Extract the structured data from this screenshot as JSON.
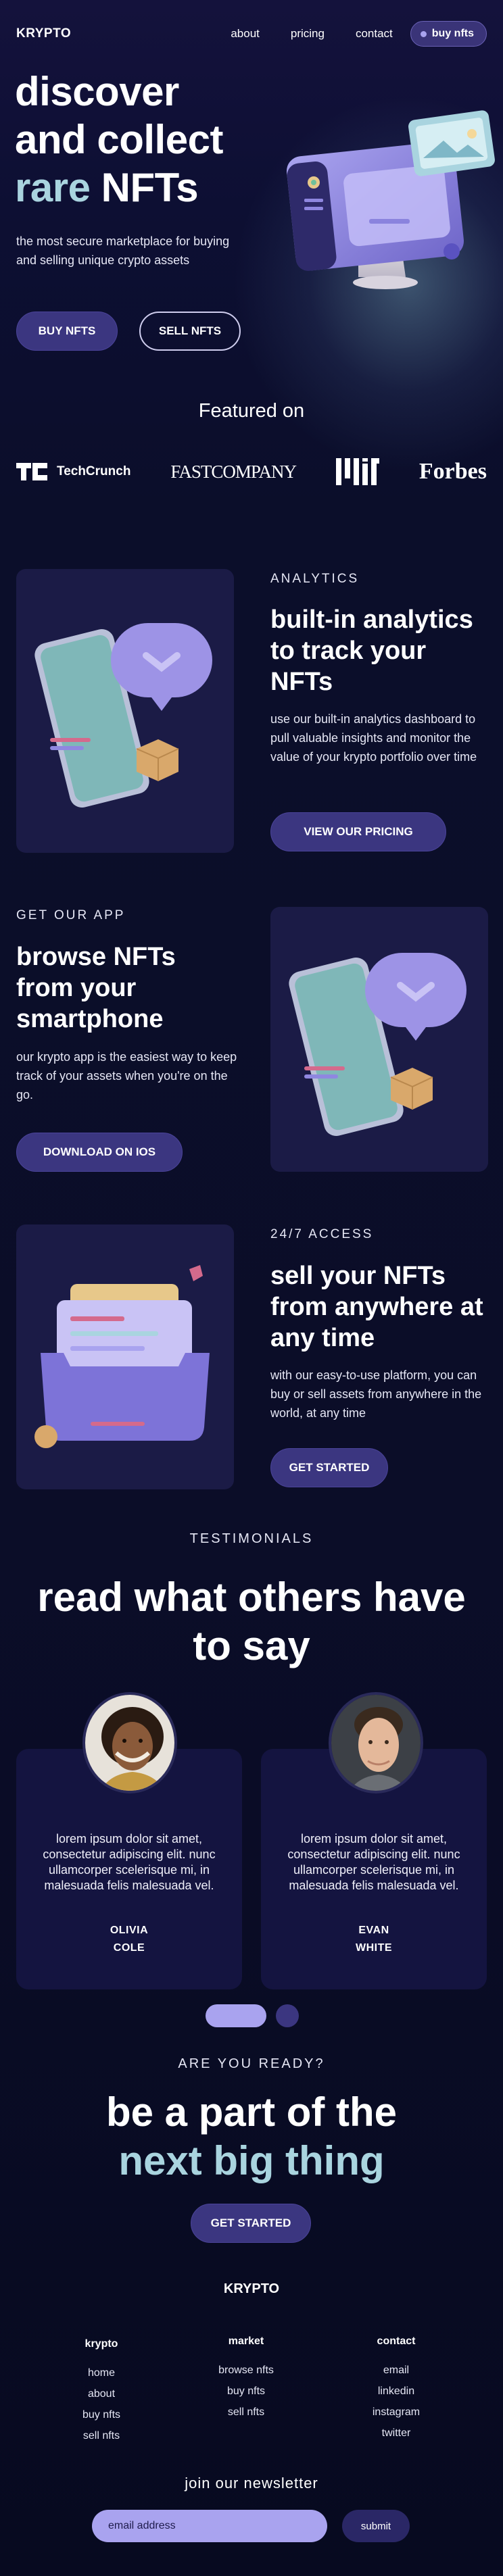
{
  "nav": {
    "brand": "KRYPTO",
    "links": [
      "about",
      "pricing",
      "contact"
    ],
    "cta": "buy nfts"
  },
  "hero": {
    "title_line1": "discover",
    "title_line2": "and collect",
    "title_accent": "rare",
    "title_end": "NFTs",
    "subtitle": "the most secure marketplace for buying and selling unique crypto assets",
    "buy_button": "BUY NFTS",
    "sell_button": "SELL NFTS"
  },
  "featured": {
    "title": "Featured on",
    "logos": [
      "TechCrunch",
      "FASTCOMPANY",
      "MIT",
      "Forbes"
    ]
  },
  "analytics": {
    "eyebrow": "ANALYTICS",
    "title": "built-in analytics to track your NFTs",
    "body": "use our built-in analytics dashboard to pull valuable insights and monitor the value of your krypto portfolio over time",
    "button": "VIEW OUR PRICING"
  },
  "app": {
    "eyebrow": "GET OUR APP",
    "title": "browse NFTs from your smartphone",
    "body": "our krypto app is the easiest way to keep track of your assets when you're on the go.",
    "button": "DOWNLOAD ON IOS"
  },
  "access": {
    "eyebrow": "24/7 ACCESS",
    "title": "sell your NFTs from anywhere at any time",
    "body": "with our easy-to-use platform, you can buy or sell assets from anywhere in the world, at any time",
    "button": "GET STARTED"
  },
  "testimonials": {
    "eyebrow": "TESTIMONIALS",
    "title": "read what others have to say",
    "items": [
      {
        "quote": "lorem ipsum dolor sit amet, consectetur adipiscing elit. nunc ullamcorper scelerisque mi, in malesuada felis malesuada vel.",
        "first": "OLIVIA",
        "last": "COLE"
      },
      {
        "quote": "lorem ipsum dolor sit amet, consectetur adipiscing elit. nunc ullamcorper scelerisque mi, in malesuada felis malesuada vel.",
        "first": "EVAN",
        "last": "WHITE"
      }
    ]
  },
  "cta": {
    "eyebrow": "ARE YOU READY?",
    "title_line1": "be a part of the",
    "title_line2": "next big thing",
    "button": "GET STARTED"
  },
  "footer": {
    "brand": "KRYPTO",
    "columns": [
      {
        "heading": "krypto",
        "links": [
          "home",
          "about",
          "buy nfts",
          "sell nfts"
        ]
      },
      {
        "heading": "market",
        "links": [
          "browse nfts",
          "buy nfts",
          "sell nfts"
        ]
      },
      {
        "heading": "contact",
        "links": [
          "email",
          "linkedin",
          "instagram",
          "twitter"
        ]
      }
    ],
    "newsletter_title": "join our newsletter",
    "email_placeholder": "email address",
    "submit": "submit"
  },
  "colors": {
    "background": "#0b0e2a",
    "accent_teal": "#a9d4df",
    "accent_lilac": "#a9a3ef",
    "button_purple": "#3b3680"
  }
}
